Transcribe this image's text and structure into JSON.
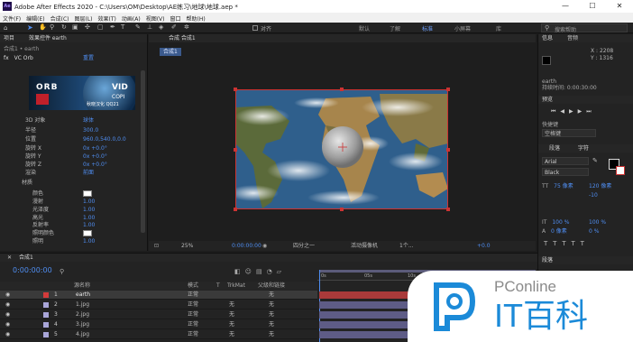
{
  "window": {
    "title": "Adobe After Effects 2020 - C:\\Users\\OM\\Desktop\\AE练习\\地球\\地球.aep *",
    "minimize": "—",
    "maximize": "☐",
    "close": "✕"
  },
  "menu": [
    "文件(F)",
    "编辑(E)",
    "合成(C)",
    "图层(L)",
    "效果(T)",
    "动画(A)",
    "视图(V)",
    "窗口",
    "帮助(H)"
  ],
  "toolbar": {
    "align_label": "对齐",
    "workspaces": [
      "默认",
      "了解",
      "标准",
      "小屏幕",
      "库"
    ],
    "active_workspace": "标准",
    "search_placeholder": "搜索帮助"
  },
  "left_panel": {
    "tabs": [
      "项目",
      "效果控件 earth"
    ],
    "breadcrumb": "合成1 • earth",
    "effect_name": "VC Orb",
    "reset": "重置",
    "preview_line1": "ORB",
    "preview_line2": "VID",
    "preview_line3": "COPI",
    "preview_caption": "秋晓汉化 QQ21",
    "properties": [
      {
        "label": "3D 对象",
        "value": "球体"
      },
      {
        "label": "半径",
        "value": "300.0"
      },
      {
        "label": "位置",
        "value": "960.0,540.0,0.0"
      },
      {
        "label": "旋转 X",
        "value": "0x +0.0°"
      },
      {
        "label": "旋转 Y",
        "value": "0x +0.0°"
      },
      {
        "label": "旋转 Z",
        "value": "0x +0.0°"
      },
      {
        "label": "渲染",
        "value": "前面"
      },
      {
        "label": "材质",
        "value": ""
      },
      {
        "label": "颜色",
        "value": ""
      },
      {
        "label": "漫射",
        "value": "1.00"
      },
      {
        "label": "光泽度",
        "value": "1.00"
      },
      {
        "label": "高光",
        "value": "1.00"
      },
      {
        "label": "反射率",
        "value": "1.00"
      },
      {
        "label": "照明颜色",
        "value": ""
      },
      {
        "label": "照明",
        "value": "1.00"
      }
    ]
  },
  "composition": {
    "tab": "合成 合成1",
    "sub_tab": "合成1",
    "zoom": "25%",
    "timecode": "0:00:00:00",
    "resolution": "四分之一",
    "camera": "活动摄像机",
    "views": "1个...",
    "exposure": "+0.0"
  },
  "info_panel": {
    "tabs": [
      "信息",
      "音频"
    ],
    "x_label": "X : 2208",
    "y_label": "Y : 1316",
    "layer_name": "earth",
    "duration": "持续时间: 0:00:30:00",
    "preview_tab": "预览",
    "shortcut_label": "快捷键",
    "shortcut_value": "空格键",
    "char_tab_1": "段落",
    "char_tab_2": "字符",
    "font": "Arial",
    "style": "Black",
    "font_size": "75 像素",
    "leading": "120 像素",
    "tracking": "-10",
    "scale_v": "100 %",
    "scale_h": "100 %",
    "baseline": "0 像素",
    "tsume": "0 %",
    "bottom_tab": "段落"
  },
  "timeline": {
    "tab": "合成1",
    "timecode": "0:00:00:00",
    "col_source": "源名称",
    "col_mode": "模式",
    "col_t": "T",
    "col_trkmat": "TrkMat",
    "col_parent": "父级和链接",
    "ruler": [
      "0s",
      "05s",
      "10s",
      "15s",
      "20s"
    ],
    "layers": [
      {
        "num": "1",
        "name": "earth",
        "color": "#d43b3b",
        "mode": "正常",
        "trkmat": "",
        "parent": "无",
        "selected": true
      },
      {
        "num": "2",
        "name": "1.jpg",
        "color": "#a9a6d9",
        "mode": "正常",
        "trkmat": "无",
        "parent": "无",
        "selected": false
      },
      {
        "num": "3",
        "name": "2.jpg",
        "color": "#a9a6d9",
        "mode": "正常",
        "trkmat": "无",
        "parent": "无",
        "selected": false
      },
      {
        "num": "4",
        "name": "3.jpg",
        "color": "#a9a6d9",
        "mode": "正常",
        "trkmat": "无",
        "parent": "无",
        "selected": false
      },
      {
        "num": "5",
        "name": "4.jpg",
        "color": "#a9a6d9",
        "mode": "正常",
        "trkmat": "无",
        "parent": "无",
        "selected": false
      }
    ]
  },
  "watermark": {
    "brand_top": "PConline",
    "brand_bottom": "IT百科"
  }
}
